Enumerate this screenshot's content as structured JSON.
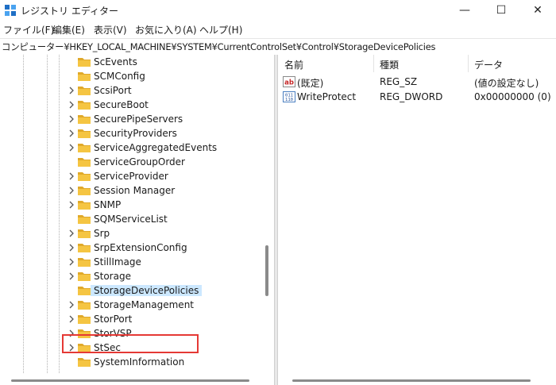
{
  "window": {
    "title": "レジストリ エディター",
    "minimize_glyph": "—",
    "maximize_glyph": "☐",
    "close_glyph": "✕"
  },
  "menu": [
    "ファイル(F)",
    "編集(E)",
    "表示(V)",
    "お気に入り(A)",
    "ヘルプ(H)"
  ],
  "address": "コンピューター¥HKEY_LOCAL_MACHINE¥SYSTEM¥CurrentControlSet¥Control¥StorageDevicePolicies",
  "tree": {
    "items": [
      {
        "label": "ScEvents",
        "expandable": false
      },
      {
        "label": "SCMConfig",
        "expandable": false
      },
      {
        "label": "ScsiPort",
        "expandable": true
      },
      {
        "label": "SecureBoot",
        "expandable": true
      },
      {
        "label": "SecurePipeServers",
        "expandable": true
      },
      {
        "label": "SecurityProviders",
        "expandable": true
      },
      {
        "label": "ServiceAggregatedEvents",
        "expandable": true
      },
      {
        "label": "ServiceGroupOrder",
        "expandable": false
      },
      {
        "label": "ServiceProvider",
        "expandable": true
      },
      {
        "label": "Session Manager",
        "expandable": true
      },
      {
        "label": "SNMP",
        "expandable": true
      },
      {
        "label": "SQMServiceList",
        "expandable": false
      },
      {
        "label": "Srp",
        "expandable": true
      },
      {
        "label": "SrpExtensionConfig",
        "expandable": true
      },
      {
        "label": "StillImage",
        "expandable": true
      },
      {
        "label": "Storage",
        "expandable": true
      },
      {
        "label": "StorageDevicePolicies",
        "expandable": false,
        "selected": true
      },
      {
        "label": "StorageManagement",
        "expandable": true
      },
      {
        "label": "StorPort",
        "expandable": true
      },
      {
        "label": "StorVSP",
        "expandable": true
      },
      {
        "label": "StSec",
        "expandable": true
      },
      {
        "label": "SystemInformation",
        "expandable": false
      }
    ]
  },
  "list": {
    "headers": {
      "name": "名前",
      "type": "種類",
      "data": "データ"
    },
    "rows": [
      {
        "icon": "string-value-icon",
        "name": "(既定)",
        "type": "REG_SZ",
        "data": "(値の設定なし)"
      },
      {
        "icon": "binary-value-icon",
        "name": "WriteProtect",
        "type": "REG_DWORD",
        "data": "0x00000000 (0)"
      }
    ]
  },
  "colors": {
    "folder": "#f5c542",
    "folder_dark": "#e0a92a",
    "selection": "#cce8ff",
    "highlight_outline": "#e53935",
    "app_icon": "#1f6fc5"
  }
}
